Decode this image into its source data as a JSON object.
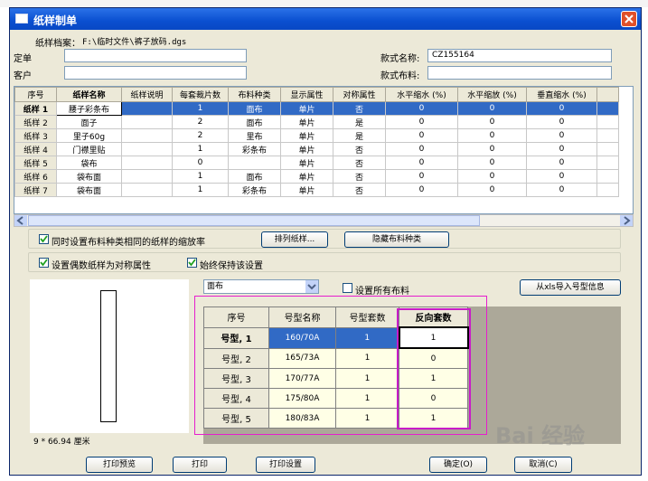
{
  "window": {
    "title": "纸样制单"
  },
  "header": {
    "file_label": "纸样档案：",
    "file_path": "F:\\临时文件\\裤子放码.dgs",
    "order_label": "定单",
    "order_value": "",
    "customer_label": "客户",
    "customer_value": "",
    "style_label": "款式名称:",
    "style_value": "CZ155164",
    "fabric_label": "款式布料:",
    "fabric_value": ""
  },
  "pieces_table": {
    "columns": [
      "序号",
      "纸样名称",
      "纸样说明",
      "每套裁片数",
      "布料种类",
      "显示属性",
      "对称属性",
      "水平缩水 (%)",
      "水平缩放 (%)",
      "垂直缩水 (%)"
    ],
    "rows": [
      [
        "纸样 1",
        "腰子彩条布",
        "",
        "1",
        "面布",
        "单片",
        "否",
        "0",
        "0",
        "0"
      ],
      [
        "纸样 2",
        "面子",
        "",
        "2",
        "面布",
        "单片",
        "是",
        "0",
        "0",
        "0"
      ],
      [
        "纸样 3",
        "里子60g",
        "",
        "2",
        "里布",
        "单片",
        "是",
        "0",
        "0",
        "0"
      ],
      [
        "纸样 4",
        "门襟里贴",
        "",
        "1",
        "彩条布",
        "单片",
        "否",
        "0",
        "0",
        "0"
      ],
      [
        "纸样 5",
        "袋布",
        "",
        "0",
        "",
        "单片",
        "否",
        "0",
        "0",
        "0"
      ],
      [
        "纸样 6",
        "袋布面",
        "",
        "1",
        "面布",
        "单片",
        "否",
        "0",
        "0",
        "0"
      ],
      [
        "纸样 7",
        "袋布面",
        "",
        "1",
        "彩条布",
        "单片",
        "否",
        "0",
        "0",
        "0"
      ]
    ]
  },
  "options": {
    "same_ratio_label": "同时设置布料种类相同的纸样的缩放率",
    "same_ratio_checked": true,
    "arrange_button": "排列纸样...",
    "hide_fabric_button": "隐藏布料种类",
    "even_symmetric_label": "设置偶数纸样为对称属性",
    "even_symmetric_checked": true,
    "keep_setting_label": "始终保持该设置",
    "keep_setting_checked": true
  },
  "fabric_select": {
    "value": "面布"
  },
  "all_fabric": {
    "label": "设置所有布料",
    "checked": false
  },
  "import_button": "从xls导入号型信息",
  "size_table": {
    "columns": [
      "序号",
      "号型名称",
      "号型套数",
      "反向套数"
    ],
    "rows": [
      [
        "号型, 1",
        "160/70A",
        "1",
        "1"
      ],
      [
        "号型, 2",
        "165/73A",
        "1",
        "0"
      ],
      [
        "号型, 3",
        "170/77A",
        "1",
        "1"
      ],
      [
        "号型, 4",
        "175/80A",
        "1",
        "0"
      ],
      [
        "号型, 5",
        "180/83A",
        "1",
        "1"
      ]
    ]
  },
  "preview": {
    "dimension_text": "9 * 66.94 厘米"
  },
  "footer": {
    "print_preview": "打印预览",
    "print": "打印",
    "print_settings": "打印设置",
    "ok": "确定(O)",
    "cancel": "取消(C)"
  },
  "watermark": {
    "text": "Bai 经验"
  }
}
